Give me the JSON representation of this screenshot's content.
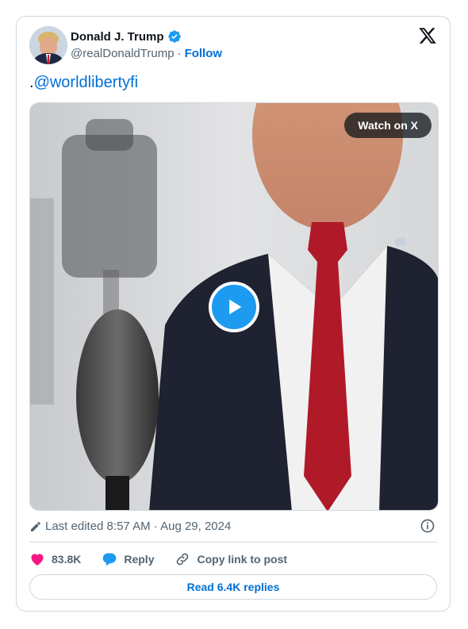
{
  "author": {
    "display_name": "Donald J. Trump",
    "handle": "@realDonaldTrump",
    "separator": "·",
    "follow_label": "Follow"
  },
  "tweet": {
    "prefix": ".",
    "mention": "@worldlibertyfi"
  },
  "media": {
    "watch_label": "Watch on X"
  },
  "meta": {
    "edited_text": "Last edited 8:57 AM · Aug 29, 2024"
  },
  "actions": {
    "likes_count": "83.8K",
    "reply_label": "Reply",
    "copy_link_label": "Copy link to post",
    "read_replies_label": "Read 6.4K replies"
  },
  "colors": {
    "accent": "#1d9bf0",
    "link": "#006fd6",
    "like": "#f91880",
    "muted": "#536471",
    "border": "#cfd9de"
  },
  "icons": [
    "verified-badge-icon",
    "x-logo-icon",
    "play-icon",
    "pencil-icon",
    "info-icon",
    "heart-icon",
    "reply-bubble-icon",
    "link-icon"
  ]
}
